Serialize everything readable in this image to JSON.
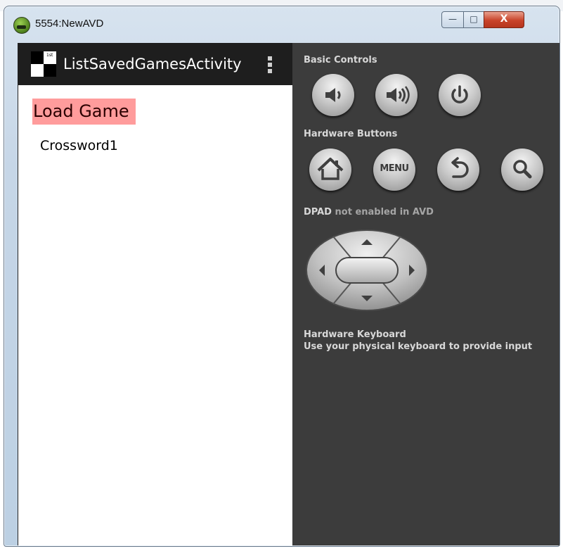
{
  "window": {
    "title": "5554:NewAVD",
    "minimize_label": "—",
    "maximize_label": "□",
    "close_label": "X"
  },
  "phone": {
    "action_bar_title": "ListSavedGamesActivity",
    "header_text": "Load Game",
    "items": [
      {
        "label": "Crossword1"
      }
    ]
  },
  "controls": {
    "basic_controls_label": "Basic Controls",
    "hardware_buttons_label": "Hardware Buttons",
    "menu_button_label": "MENU",
    "dpad_label": "DPAD",
    "dpad_status": "not enabled in AVD",
    "keyboard_title": "Hardware Keyboard",
    "keyboard_desc": "Use your physical keyboard to provide input"
  },
  "icons": {
    "volume_down": "speaker-low-icon",
    "volume_up": "speaker-high-icon",
    "power": "power-icon",
    "home": "house-icon",
    "back": "back-arrow-icon",
    "search": "magnifier-icon"
  },
  "colors": {
    "selected_header_bg": "#ff9c9c",
    "action_bar_bg": "#1e1e1e",
    "panel_bg": "#3c3c3c",
    "close_button": "#c9432a"
  }
}
